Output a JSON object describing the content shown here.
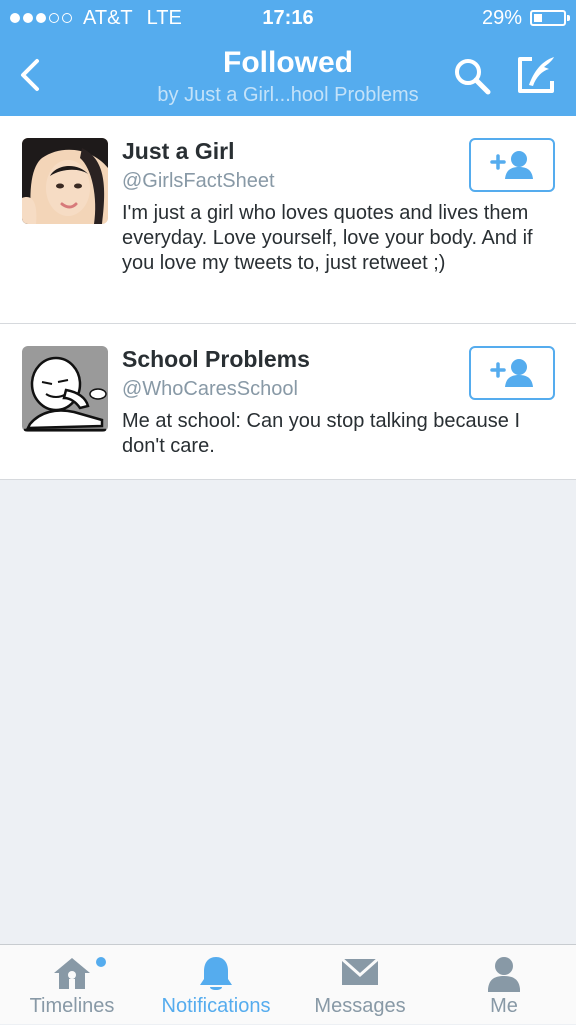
{
  "status_bar": {
    "carrier": "AT&T",
    "network": "LTE",
    "time": "17:16",
    "battery": "29%",
    "battery_level": 0.29,
    "signal_bars": 3
  },
  "nav": {
    "title": "Followed",
    "subtitle": "by Just a Girl...hool Problems",
    "back_icon": "chevron-left-icon",
    "search_icon": "search-icon",
    "compose_icon": "compose-icon"
  },
  "users": [
    {
      "name": "Just a Girl",
      "handle": "@GirlsFactSheet",
      "bio": "I'm just a girl who loves quotes and lives them everyday. Love yourself, love your body. And if you love my tweets to, just retweet ;)",
      "follow_icon": "add-user-icon"
    },
    {
      "name": "School Problems",
      "handle": "@WhoCaresSchool",
      "bio": "Me at school: Can you stop talking because I don't care.",
      "follow_icon": "add-user-icon"
    }
  ],
  "tabs": [
    {
      "label": "Timelines",
      "icon": "home-icon",
      "active": false,
      "has_badge": true
    },
    {
      "label": "Notifications",
      "icon": "bell-icon",
      "active": true,
      "has_badge": false
    },
    {
      "label": "Messages",
      "icon": "envelope-icon",
      "active": false,
      "has_badge": false
    },
    {
      "label": "Me",
      "icon": "person-icon",
      "active": false,
      "has_badge": false
    }
  ],
  "colors": {
    "accent": "#55acee",
    "text": "#292f33",
    "muted": "#8899a6",
    "background": "#edf0f4"
  }
}
